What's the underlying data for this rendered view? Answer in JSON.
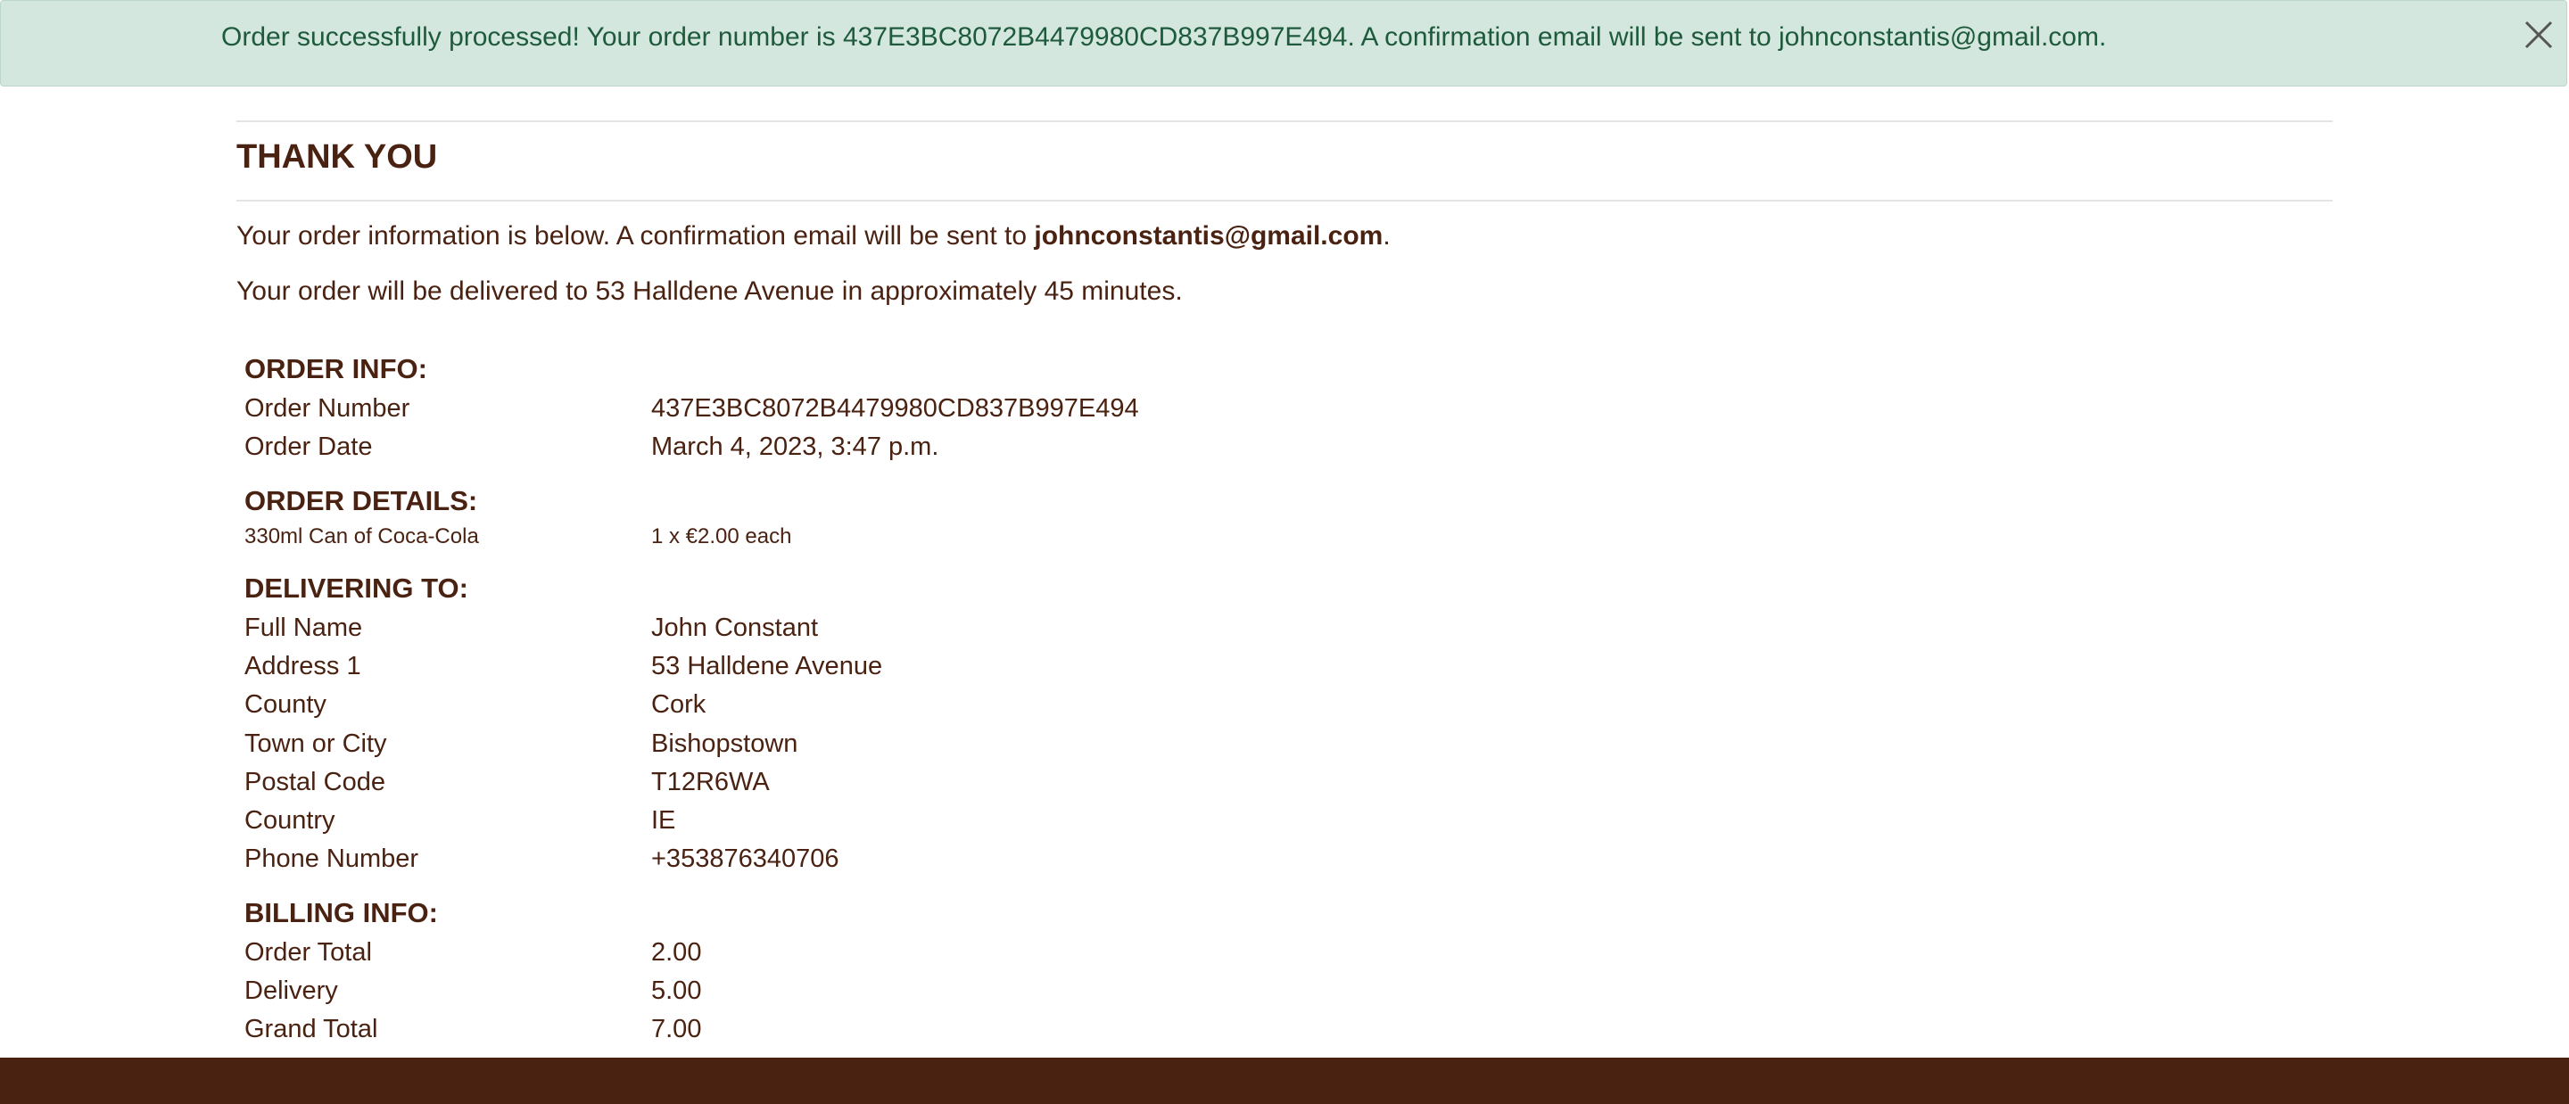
{
  "alert": {
    "message": "Order successfully processed! Your order number is 437E3BC8072B4479980CD837B997E494. A confirmation email will be sent to johnconstantis@gmail.com.",
    "close_icon": "close-icon"
  },
  "page": {
    "title": "THANK YOU",
    "intro_prefix": "Your order information is below. A confirmation email will be sent to ",
    "intro_email": "johnconstantis@gmail.com",
    "intro_suffix": ".",
    "delivery_note": "Your order will be delivered to 53 Halldene Avenue in approximately 45 minutes."
  },
  "order_info": {
    "heading": "ORDER INFO:",
    "order_number_label": "Order Number",
    "order_number": "437E3BC8072B4479980CD837B997E494",
    "order_date_label": "Order Date",
    "order_date": "March 4, 2023, 3:47 p.m."
  },
  "order_details": {
    "heading": "ORDER DETAILS:",
    "items": [
      {
        "name": "330ml Can of Coca-Cola",
        "qty_price": "1 x €2.00 each"
      }
    ]
  },
  "delivering_to": {
    "heading": "DELIVERING TO:",
    "rows": [
      {
        "label": "Full Name",
        "value": "John Constant"
      },
      {
        "label": "Address 1",
        "value": "53 Halldene Avenue"
      },
      {
        "label": "County",
        "value": "Cork"
      },
      {
        "label": "Town or City",
        "value": "Bishopstown"
      },
      {
        "label": "Postal Code",
        "value": "T12R6WA"
      },
      {
        "label": "Country",
        "value": "IE"
      },
      {
        "label": "Phone Number",
        "value": "+353876340706"
      }
    ]
  },
  "billing_info": {
    "heading": "BILLING INFO:",
    "rows": [
      {
        "label": "Order Total",
        "value": "2.00"
      },
      {
        "label": "Delivery",
        "value": "5.00"
      },
      {
        "label": "Grand Total",
        "value": "7.00"
      }
    ]
  },
  "colors": {
    "brand_brown": "#4a2212",
    "alert_background": "#d4e7df",
    "alert_text": "#1e5a3c"
  }
}
